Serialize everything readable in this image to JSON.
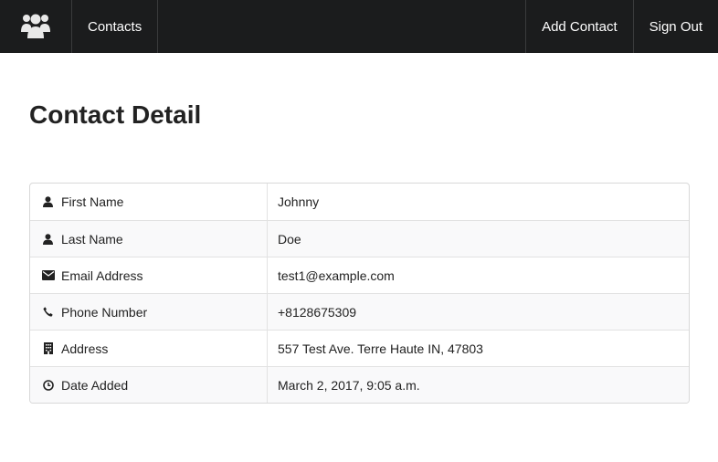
{
  "nav": {
    "logo_icon": "users-icon",
    "contacts_label": "Contacts",
    "add_contact_label": "Add Contact",
    "sign_out_label": "Sign Out"
  },
  "page": {
    "title": "Contact Detail"
  },
  "details": [
    {
      "icon": "user-icon",
      "label": "First Name",
      "value": "Johnny"
    },
    {
      "icon": "user-icon",
      "label": "Last Name",
      "value": "Doe"
    },
    {
      "icon": "envelope-icon",
      "label": "Email Address",
      "value": "test1@example.com"
    },
    {
      "icon": "phone-icon",
      "label": "Phone Number",
      "value": "+8128675309"
    },
    {
      "icon": "building-icon",
      "label": "Address",
      "value": "557 Test Ave. Terre Haute IN, 47803"
    },
    {
      "icon": "clock-icon",
      "label": "Date Added",
      "value": "March 2, 2017, 9:05 a.m."
    }
  ],
  "colors": {
    "navbar_bg": "#1b1c1d",
    "stripe_bg": "#f9f9fa",
    "border": "#d8d8d8"
  }
}
